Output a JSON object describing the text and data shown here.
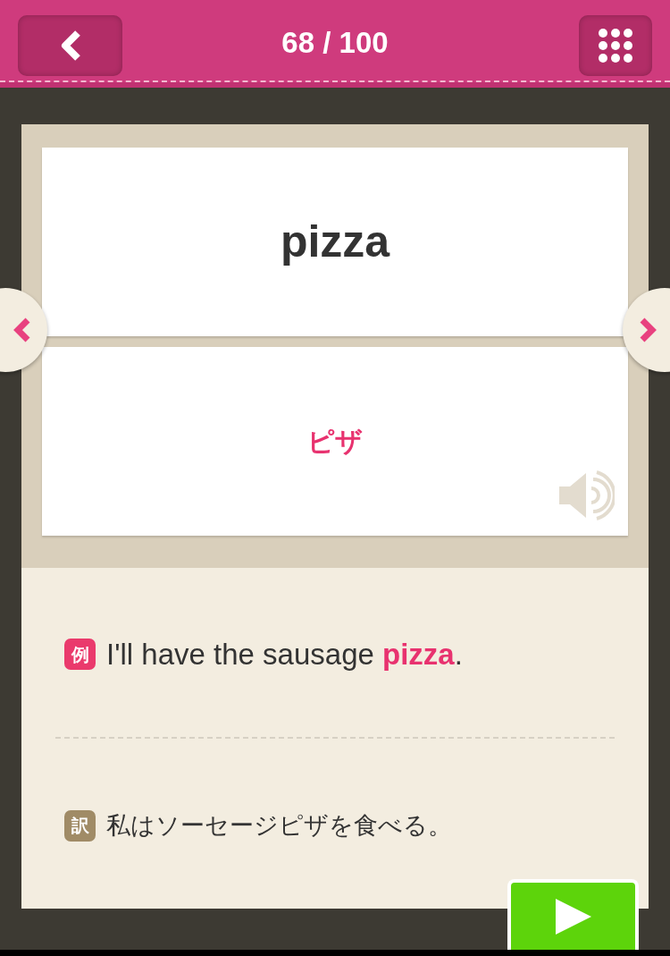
{
  "header": {
    "counter": "68 / 100"
  },
  "card": {
    "word": "pizza",
    "meaning": "ピザ"
  },
  "example": {
    "badge": "例",
    "sentence": "I'll have the sausage **pizza**."
  },
  "translation": {
    "badge": "訳",
    "sentence": "私はソーセージピザを食べる。"
  }
}
